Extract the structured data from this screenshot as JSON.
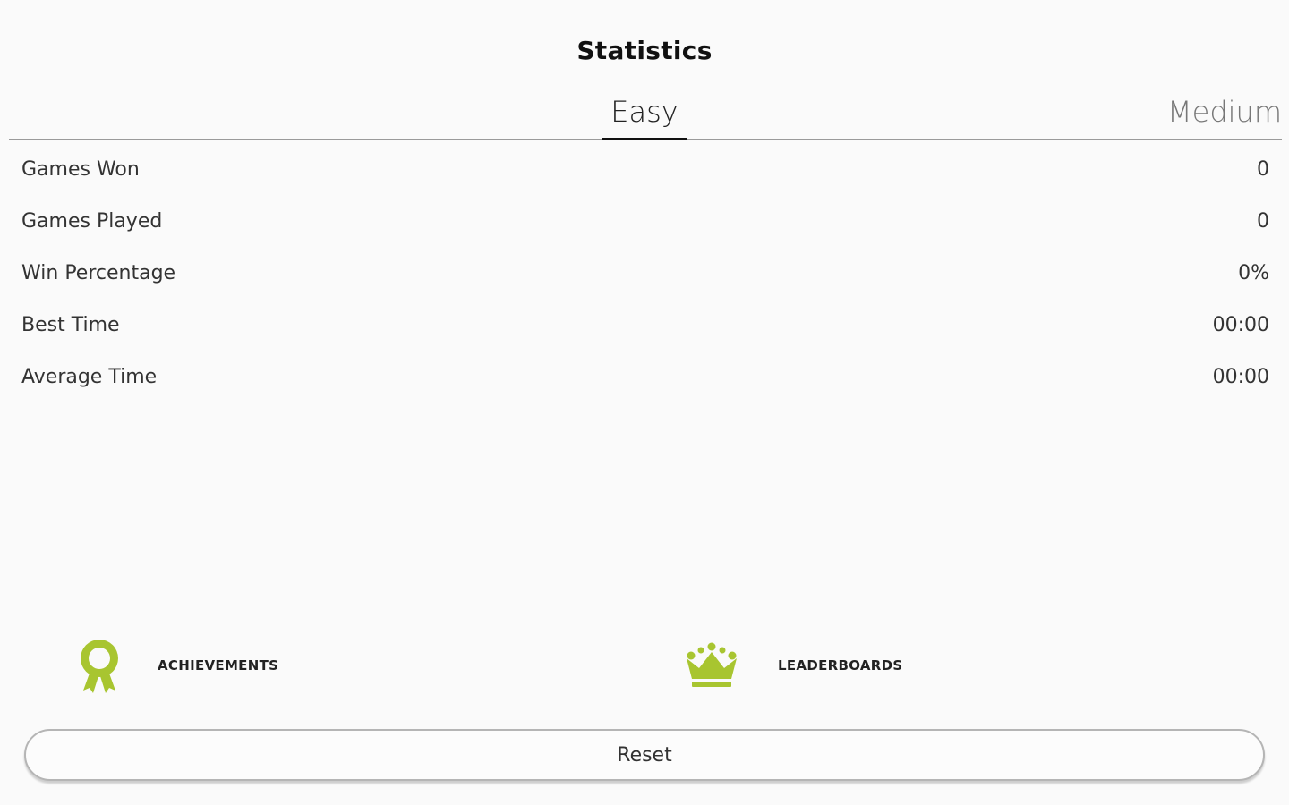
{
  "header": {
    "title": "Statistics"
  },
  "tabs": [
    {
      "label": "Easy",
      "selected": true
    },
    {
      "label": "Medium",
      "selected": false
    }
  ],
  "stats": [
    {
      "label": "Games Won",
      "value": "0"
    },
    {
      "label": "Games Played",
      "value": "0"
    },
    {
      "label": "Win Percentage",
      "value": "0%"
    },
    {
      "label": "Best Time",
      "value": "00:00"
    },
    {
      "label": "Average Time",
      "value": "00:00"
    }
  ],
  "actions": {
    "achievements": {
      "label": "ACHIEVEMENTS",
      "icon": "award-ribbon-icon"
    },
    "leaderboards": {
      "label": "LEADERBOARDS",
      "icon": "crown-icon"
    }
  },
  "reset": {
    "label": "Reset"
  },
  "colors": {
    "accent": "#a8c530",
    "background": "#fafafa",
    "tab_indicator": "#111111"
  }
}
